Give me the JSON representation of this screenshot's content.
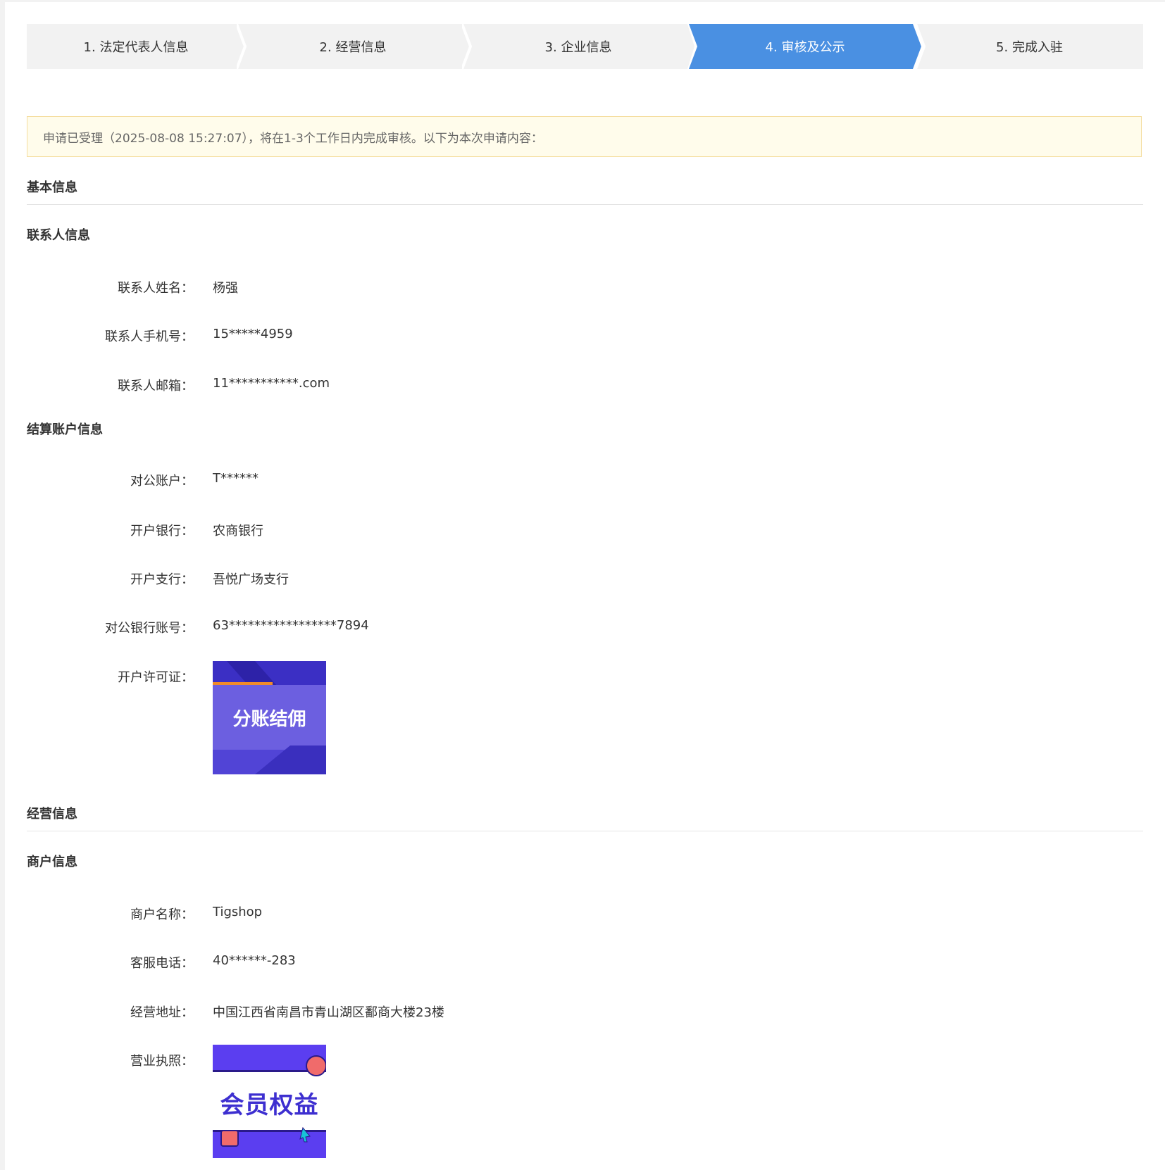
{
  "steps": [
    {
      "label": "1. 法定代表人信息",
      "active": false
    },
    {
      "label": "2. 经营信息",
      "active": false
    },
    {
      "label": "3. 企业信息",
      "active": false
    },
    {
      "label": "4. 审核及公示",
      "active": true
    },
    {
      "label": "5. 完成入驻",
      "active": false
    }
  ],
  "colors": {
    "step_bg": "#f2f2f2",
    "step_active": "#4a90e2",
    "notice_bg": "#fffceb",
    "notice_border": "#f5dea0"
  },
  "notice": "申请已受理（2025-08-08 15:27:07），将在1-3个工作日内完成审核。以下为本次申请内容：",
  "basic": {
    "title": "基本信息",
    "contact": {
      "title": "联系人信息",
      "name_label": "联系人姓名：",
      "name_value": "杨强",
      "phone_label": "联系人手机号：",
      "phone_value": "15*****4959",
      "email_label": "联系人邮箱：",
      "email_value": "11***********.com"
    },
    "settlement": {
      "title": "结算账户信息",
      "account_label": "对公账户：",
      "account_value": "T******",
      "bank_label": "开户银行：",
      "bank_value": "农商银行",
      "branch_label": "开户支行：",
      "branch_value": "吾悦广场支行",
      "number_label": "对公银行账号：",
      "number_value": "63*****************7894",
      "license_label": "开户许可证：",
      "license_image_text": "分账结佣"
    }
  },
  "business": {
    "title": "经营信息",
    "merchant": {
      "title": "商户信息",
      "name_label": "商户名称：",
      "name_value": "Tigshop",
      "service_label": "客服电话：",
      "service_value": "40******-283",
      "address_label": "经营地址：",
      "address_value": "中国江西省南昌市青山湖区鄱商大楼23楼",
      "license_label": "营业执照：",
      "license_image_text": "会员权益"
    }
  }
}
